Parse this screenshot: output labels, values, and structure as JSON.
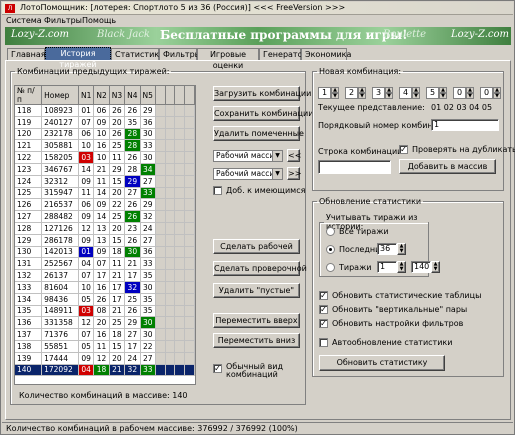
{
  "window": {
    "title": "ЛотоПомощник: [лотерея: Спортлото 5 из 36 (Россия)]        <<< FreeVersion >>>"
  },
  "menu": [
    "Система",
    "Фильтры",
    "Помощь"
  ],
  "banner": {
    "left1": "Lozy-Z.com",
    "left2": "Black Jack",
    "center": "Бесплатные программы для игры!",
    "right1": "Roulette",
    "right2": "Lozy-Z.com"
  },
  "tabs": [
    "Главная",
    "История тиражей",
    "Статистика",
    "Фильтры",
    "Игровые оценки",
    "Генератор",
    "Экономика"
  ],
  "combos": {
    "legend": "Комбинации предыдущих тиражей:",
    "headers": [
      "№ п/п",
      "Номер",
      "N1",
      "N2",
      "N3",
      "N4",
      "N5"
    ],
    "rows": [
      {
        "n": "118",
        "num": "108923",
        "v": [
          "01",
          "06",
          "26",
          "26",
          "29"
        ],
        "c": [
          "",
          "",
          "",
          "",
          ""
        ]
      },
      {
        "n": "119",
        "num": "240127",
        "v": [
          "07",
          "09",
          "20",
          "35",
          "36"
        ],
        "c": [
          "",
          "",
          "",
          "",
          ""
        ]
      },
      {
        "n": "120",
        "num": "232178",
        "v": [
          "06",
          "10",
          "26",
          "28",
          "30"
        ],
        "c": [
          "",
          "",
          "",
          "green",
          ""
        ]
      },
      {
        "n": "121",
        "num": "305881",
        "v": [
          "10",
          "16",
          "25",
          "28",
          "33"
        ],
        "c": [
          "",
          "",
          "",
          "green",
          ""
        ]
      },
      {
        "n": "122",
        "num": "158205",
        "v": [
          "03",
          "10",
          "11",
          "26",
          "30"
        ],
        "c": [
          "red",
          "",
          "",
          "",
          ""
        ]
      },
      {
        "n": "123",
        "num": "346767",
        "v": [
          "14",
          "21",
          "29",
          "28",
          "34"
        ],
        "c": [
          "",
          "",
          "",
          "",
          "green"
        ]
      },
      {
        "n": "124",
        "num": "32312",
        "v": [
          "09",
          "11",
          "15",
          "29",
          "27"
        ],
        "c": [
          "",
          "",
          "",
          "blue",
          ""
        ]
      },
      {
        "n": "125",
        "num": "315947",
        "v": [
          "11",
          "14",
          "20",
          "27",
          "33"
        ],
        "c": [
          "",
          "",
          "",
          "",
          "green"
        ]
      },
      {
        "n": "126",
        "num": "216537",
        "v": [
          "06",
          "09",
          "22",
          "26",
          "29"
        ],
        "c": [
          "",
          "",
          "",
          "",
          ""
        ]
      },
      {
        "n": "127",
        "num": "288482",
        "v": [
          "09",
          "14",
          "25",
          "26",
          "32"
        ],
        "c": [
          "",
          "",
          "",
          "green",
          ""
        ]
      },
      {
        "n": "128",
        "num": "127126",
        "v": [
          "12",
          "13",
          "20",
          "23",
          "24"
        ],
        "c": [
          "",
          "",
          "",
          "",
          ""
        ]
      },
      {
        "n": "129",
        "num": "286178",
        "v": [
          "09",
          "13",
          "15",
          "26",
          "27"
        ],
        "c": [
          "",
          "",
          "",
          "",
          ""
        ]
      },
      {
        "n": "130",
        "num": "142013",
        "v": [
          "01",
          "09",
          "18",
          "30",
          "36"
        ],
        "c": [
          "blue",
          "",
          "",
          "green",
          ""
        ]
      },
      {
        "n": "131",
        "num": "252567",
        "v": [
          "04",
          "07",
          "11",
          "21",
          "33"
        ],
        "c": [
          "",
          "",
          "",
          "",
          ""
        ]
      },
      {
        "n": "132",
        "num": "26137",
        "v": [
          "07",
          "17",
          "21",
          "17",
          "35"
        ],
        "c": [
          "",
          "",
          "",
          "",
          ""
        ]
      },
      {
        "n": "133",
        "num": "81604",
        "v": [
          "10",
          "16",
          "17",
          "32",
          "30"
        ],
        "c": [
          "",
          "",
          "",
          "blue",
          ""
        ]
      },
      {
        "n": "134",
        "num": "98436",
        "v": [
          "05",
          "26",
          "17",
          "25",
          "35"
        ],
        "c": [
          "",
          "",
          "",
          "",
          ""
        ]
      },
      {
        "n": "135",
        "num": "148911",
        "v": [
          "03",
          "08",
          "21",
          "26",
          "35"
        ],
        "c": [
          "red",
          "",
          "",
          "",
          ""
        ]
      },
      {
        "n": "136",
        "num": "331358",
        "v": [
          "12",
          "20",
          "25",
          "29",
          "30"
        ],
        "c": [
          "",
          "",
          "",
          "",
          "green"
        ]
      },
      {
        "n": "137",
        "num": "71376",
        "v": [
          "07",
          "16",
          "18",
          "27",
          "30"
        ],
        "c": [
          "",
          "",
          "",
          "",
          ""
        ]
      },
      {
        "n": "138",
        "num": "55851",
        "v": [
          "05",
          "11",
          "15",
          "17",
          "22"
        ],
        "c": [
          "",
          "",
          "",
          "",
          ""
        ]
      },
      {
        "n": "139",
        "num": "17444",
        "v": [
          "09",
          "12",
          "20",
          "24",
          "27"
        ],
        "c": [
          "",
          "",
          "",
          "",
          ""
        ]
      },
      {
        "n": "140",
        "num": "172092",
        "v": [
          "04",
          "18",
          "21",
          "32",
          "33"
        ],
        "c": [
          "red",
          "green",
          "",
          "",
          "green"
        ]
      }
    ],
    "count_label": "Количество комбинаций в массиве:",
    "count": "140"
  },
  "buttons": {
    "load": "Загрузить комбинации",
    "save": "Сохранить комбинации",
    "delete_marked": "Удалить помеченные",
    "array1": "Рабочий массив",
    "array2": "Рабочий массив",
    "add_existing": "Доб. к имеющимся",
    "make_working": "Сделать рабочей",
    "make_check": "Сделать проверочной",
    "delete_empty": "Удалить \"пустые\"",
    "move_up": "Переместить вверх",
    "move_down": "Переместить вниз",
    "normal_view": "Обычный вид комбинаций"
  },
  "new_combo": {
    "legend": "Новая комбинация:",
    "spins": [
      "1",
      "2",
      "3",
      "4",
      "5",
      "0",
      "0"
    ],
    "repr_label": "Текущее представление:",
    "repr_value": "01 02 03 04 05",
    "order_label": "Порядковый номер комбинации:",
    "order_value": "1",
    "string_label": "Строка комбинации:",
    "check_dup": "Проверять на дубликаты",
    "add_btn": "Добавить в массив"
  },
  "stats": {
    "legend": "Обновление статистики",
    "sub_legend": "Учитывать тиражи из истории:",
    "all": "Все тиражи",
    "last": "Последние",
    "last_value": "36",
    "draws": "Тиражи",
    "from": "1",
    "to": "140",
    "chk1": "Обновить статистические таблицы",
    "chk2": "Обновить \"вертикальные\" пары",
    "chk3": "Обновить настройки фильтров",
    "auto": "Автообновление статистики",
    "update_btn": "Обновить статистику"
  },
  "status": "Количество комбинаций в рабочем массиве: 376992 / 376992 (100%)"
}
